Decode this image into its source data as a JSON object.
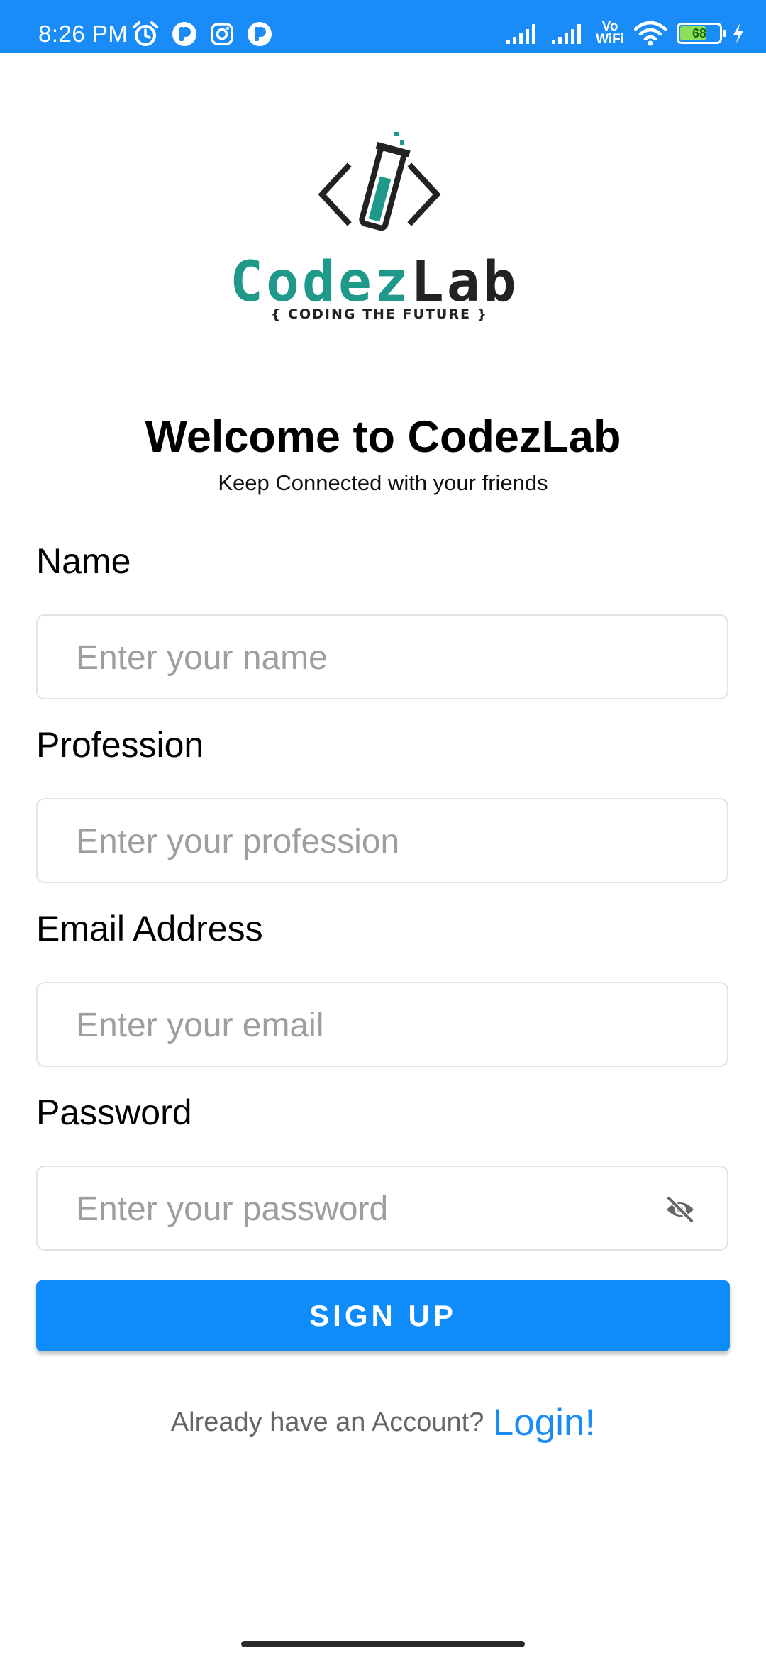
{
  "status_bar": {
    "time": "8:26 PM",
    "left_icons": [
      "alarm-icon",
      "app-notification-icon",
      "instagram-icon",
      "app-notification-icon"
    ],
    "vowifi_top": "Vo",
    "vowifi_bottom": "WiFi",
    "battery_level": "68",
    "background_color": "#1a8cf7"
  },
  "logo": {
    "brand_codez": "Codez",
    "brand_lab": "Lab",
    "tagline": "{ CODING THE FUTURE }",
    "teal_color": "#1f9a8a",
    "dark_color": "#222222"
  },
  "header": {
    "title": "Welcome to CodezLab",
    "subtitle": "Keep Connected with your friends"
  },
  "form": {
    "name_label": "Name",
    "name_placeholder": "Enter your name",
    "profession_label": "Profession",
    "profession_placeholder": "Enter your profession",
    "email_label": "Email Address",
    "email_placeholder": "Enter your email",
    "password_label": "Password",
    "password_placeholder": "Enter your password",
    "password_toggle_icon": "eye-off-icon"
  },
  "actions": {
    "signup_label": "SIGN UP",
    "signup_color": "#0e8dfa",
    "login_prompt": "Already have an Account?",
    "login_link": "Login!"
  }
}
